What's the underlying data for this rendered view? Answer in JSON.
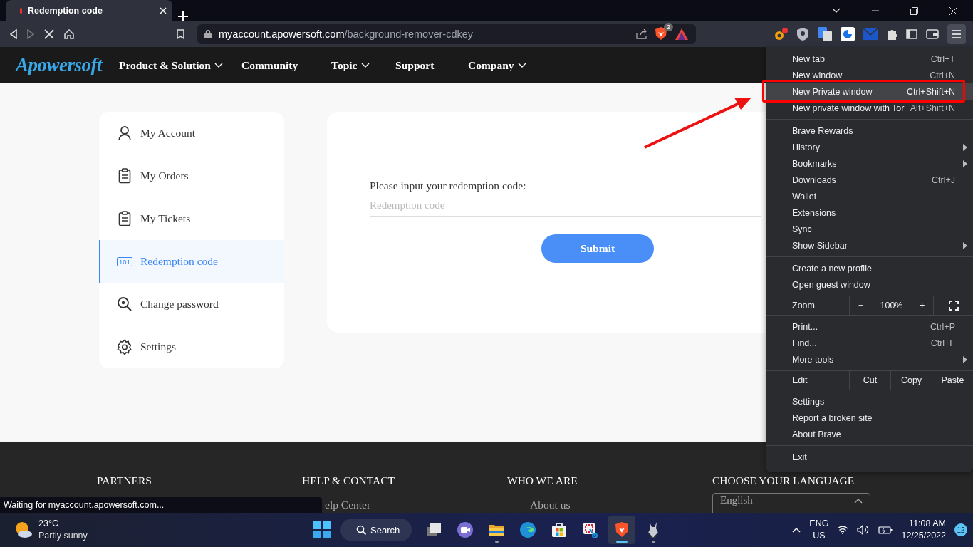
{
  "browser": {
    "tab": {
      "title": "Redemption code"
    },
    "url": {
      "host": "myaccount.apowersoft.com",
      "path": "/background-remover-cdkey"
    },
    "shields_badge": "2",
    "status": "Waiting for myaccount.apowersoft.com..."
  },
  "site_nav": {
    "logo": "Apowersoft",
    "items": [
      {
        "label": "Product & Solution",
        "dropdown": true
      },
      {
        "label": "Community",
        "dropdown": false
      },
      {
        "label": "Topic",
        "dropdown": true
      },
      {
        "label": "Support",
        "dropdown": false
      },
      {
        "label": "Company",
        "dropdown": true
      }
    ]
  },
  "sidebar": {
    "items": [
      {
        "label": "My Account",
        "selected": false
      },
      {
        "label": "My Orders",
        "selected": false
      },
      {
        "label": "My Tickets",
        "selected": false
      },
      {
        "label": "Redemption code",
        "badge": "101",
        "selected": true
      },
      {
        "label": "Change password",
        "selected": false
      },
      {
        "label": "Settings",
        "selected": false
      }
    ]
  },
  "form": {
    "label": "Please input your redemption code:",
    "placeholder": "Redemption code",
    "button": "Submit"
  },
  "footer": {
    "columns": [
      {
        "heading": "PARTNERS"
      },
      {
        "heading": "HELP & CONTACT",
        "link": "elp Center"
      },
      {
        "heading": "WHO WE ARE",
        "link": "About us"
      },
      {
        "heading": "CHOOSE YOUR LANGUAGE",
        "select": "English"
      }
    ]
  },
  "menu": {
    "sections": [
      [
        {
          "kind": "item",
          "label": "New tab",
          "shortcut": "Ctrl+T",
          "submenu": false,
          "selected": false
        },
        {
          "kind": "item",
          "label": "New window",
          "shortcut": "Ctrl+N",
          "submenu": false,
          "selected": false
        },
        {
          "kind": "item",
          "label": "New Private window",
          "shortcut": "Ctrl+Shift+N",
          "submenu": false,
          "selected": true
        },
        {
          "kind": "item",
          "label": "New private window with Tor",
          "shortcut": "Alt+Shift+N",
          "submenu": false,
          "selected": false
        }
      ],
      [
        {
          "kind": "item",
          "label": "Brave Rewards",
          "submenu": false,
          "selected": false
        },
        {
          "kind": "item",
          "label": "History",
          "submenu": true,
          "selected": false
        },
        {
          "kind": "item",
          "label": "Bookmarks",
          "submenu": true,
          "selected": false
        },
        {
          "kind": "item",
          "label": "Downloads",
          "shortcut": "Ctrl+J",
          "submenu": false,
          "selected": false
        },
        {
          "kind": "item",
          "label": "Wallet",
          "submenu": false,
          "selected": false
        },
        {
          "kind": "item",
          "label": "Extensions",
          "submenu": false,
          "selected": false
        },
        {
          "kind": "item",
          "label": "Sync",
          "submenu": false,
          "selected": false
        },
        {
          "kind": "item",
          "label": "Show Sidebar",
          "submenu": true,
          "selected": false
        }
      ],
      [
        {
          "kind": "item",
          "label": "Create a new profile",
          "submenu": false,
          "selected": false
        },
        {
          "kind": "item",
          "label": "Open guest window",
          "submenu": false,
          "selected": false
        }
      ],
      [
        {
          "kind": "zoom",
          "label": "Zoom",
          "minus": "−",
          "value": "100%",
          "plus": "+"
        }
      ],
      [
        {
          "kind": "item",
          "label": "Print...",
          "shortcut": "Ctrl+P",
          "submenu": false,
          "selected": false
        },
        {
          "kind": "item",
          "label": "Find...",
          "shortcut": "Ctrl+F",
          "submenu": false,
          "selected": false
        },
        {
          "kind": "item",
          "label": "More tools",
          "submenu": true,
          "selected": false
        }
      ],
      [
        {
          "kind": "edit",
          "label": "Edit",
          "actions": [
            "Cut",
            "Copy",
            "Paste"
          ]
        }
      ],
      [
        {
          "kind": "item",
          "label": "Settings",
          "submenu": false,
          "selected": false
        },
        {
          "kind": "item",
          "label": "Report a broken site",
          "submenu": false,
          "selected": false
        },
        {
          "kind": "item",
          "label": "About Brave",
          "submenu": false,
          "selected": false
        }
      ],
      [
        {
          "kind": "item",
          "label": "Exit",
          "submenu": false,
          "selected": false
        }
      ]
    ]
  },
  "taskbar": {
    "weather": {
      "temp": "23°C",
      "condition": "Partly sunny"
    },
    "search": "Search",
    "apps": [
      {
        "running": false,
        "active": false
      },
      {
        "running": false,
        "active": false
      },
      {
        "running": true,
        "active": false
      },
      {
        "running": false,
        "active": false
      },
      {
        "running": false,
        "active": false
      },
      {
        "running": false,
        "active": false
      },
      {
        "running": true,
        "active": true
      },
      {
        "running": true,
        "active": false
      }
    ],
    "language": "ENG",
    "region": "US",
    "time": "11:08 AM",
    "date": "12/25/2022",
    "notifications": "12"
  }
}
